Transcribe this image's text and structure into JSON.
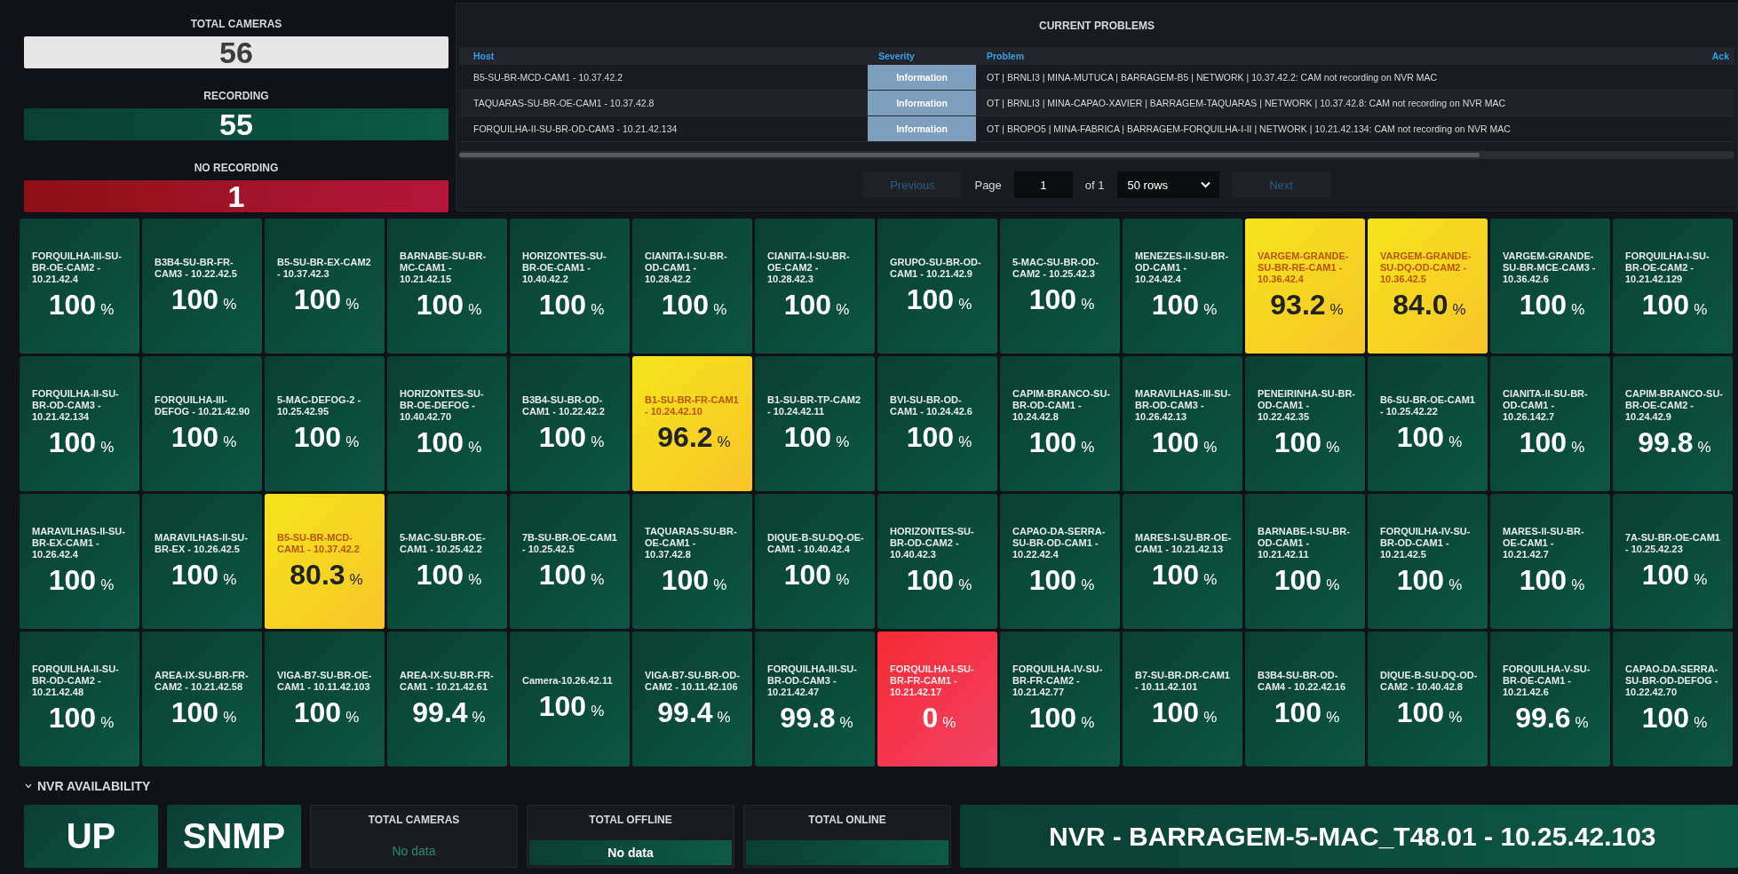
{
  "summary": [
    {
      "label": "TOTAL CAMERAS",
      "value": "56",
      "kind": "neutral"
    },
    {
      "label": "RECORDING",
      "value": "55",
      "kind": "ok"
    },
    {
      "label": "NO RECORDING",
      "value": "1",
      "kind": "critical"
    }
  ],
  "problems": {
    "title": "CURRENT PROBLEMS",
    "columns": [
      "Host",
      "Severity",
      "Problem",
      "Ack"
    ],
    "rows": [
      {
        "host": "B5-SU-BR-MCD-CAM1 - 10.37.42.2",
        "severity": "Information",
        "problem": "OT | BRNLI3 | MINA-MUTUCA | BARRAGEM-B5 | NETWORK | 10.37.42.2: CAM not recording on NVR MAC"
      },
      {
        "host": "TAQUARAS-SU-BR-OE-CAM1 - 10.37.42.8",
        "severity": "Information",
        "problem": "OT | BRNLI3 | MINA-CAPAO-XAVIER | BARRAGEM-TAQUARAS | NETWORK | 10.37.42.8: CAM not recording on NVR MAC"
      },
      {
        "host": "FORQUILHA-II-SU-BR-OD-CAM3 - 10.21.42.134",
        "severity": "Information",
        "problem": "OT | BROPO5 | MINA-FABRICA | BARRAGEM-FORQUILHA-I-II | NETWORK | 10.21.42.134: CAM not recording on NVR MAC"
      }
    ],
    "pagination": {
      "previous": "Previous",
      "page_label": "Page",
      "page": "1",
      "of": "of 1",
      "rows": "50 rows",
      "next": "Next"
    }
  },
  "tiles": [
    {
      "name": "FORQUILHA-III-SU-BR-OE-CAM2 - 10.21.42.4",
      "value": "100",
      "unit": "%",
      "color": "#0d5643"
    },
    {
      "name": "B3B4-SU-BR-FR-CAM3 - 10.22.42.5",
      "value": "100",
      "unit": "%",
      "color": "#0d5643"
    },
    {
      "name": "B5-SU-BR-EX-CAM2 - 10.37.42.3",
      "value": "100",
      "unit": "%",
      "color": "#0d5643"
    },
    {
      "name": "BARNABE-SU-BR-MC-CAM1 - 10.21.42.15",
      "value": "100",
      "unit": "%",
      "color": "#0d5643"
    },
    {
      "name": "HORIZONTES-SU-BR-OE-CAM1 - 10.40.42.2",
      "value": "100",
      "unit": "%",
      "color": "#0d5643"
    },
    {
      "name": "CIANITA-I-SU-BR-OD-CAM1 - 10.28.42.2",
      "value": "100",
      "unit": "%",
      "color": "#0d5643"
    },
    {
      "name": "CIANITA-I-SU-BR-OE-CAM2 - 10.28.42.3",
      "value": "100",
      "unit": "%",
      "color": "#0d5643"
    },
    {
      "name": "GRUPO-SU-BR-OD-CAM1 - 10.21.42.9",
      "value": "100",
      "unit": "%",
      "color": "#0d5643"
    },
    {
      "name": "5-MAC-SU-BR-OD-CAM2 - 10.25.42.3",
      "value": "100",
      "unit": "%",
      "color": "#0d5643"
    },
    {
      "name": "MENEZES-II-SU-BR-OD-CAM1 - 10.24.42.4",
      "value": "100",
      "unit": "%",
      "color": "#0d5643"
    },
    {
      "name": "VARGEM-GRANDE-SU-BR-RE-CAM1 - 10.36.42.4",
      "value": "93.2",
      "unit": "%",
      "color": "#f5e41a"
    },
    {
      "name": "VARGEM-GRANDE-SU-DQ-OD-CAM2 - 10.36.42.5",
      "value": "84.0",
      "unit": "%",
      "color": "#f5e41a"
    },
    {
      "name": "VARGEM-GRANDE-SU-BR-MCE-CAM3 - 10.36.42.6",
      "value": "100",
      "unit": "%",
      "color": "#0d5643"
    },
    {
      "name": "FORQUILHA-I-SU-BR-OE-CAM2 - 10.21.42.129",
      "value": "100",
      "unit": "%",
      "color": "#0d5643"
    },
    {
      "name": "FORQUILHA-II-SU-BR-OD-CAM3 - 10.21.42.134",
      "value": "100",
      "unit": "%",
      "color": "#0d5643"
    },
    {
      "name": "FORQUILHA-III-DEFOG - 10.21.42.90",
      "value": "100",
      "unit": "%",
      "color": "#0d5643"
    },
    {
      "name": "5-MAC-DEFOG-2 - 10.25.42.95",
      "value": "100",
      "unit": "%",
      "color": "#0d5643"
    },
    {
      "name": "HORIZONTES-SU-BR-OE-DEFOG - 10.40.42.70",
      "value": "100",
      "unit": "%",
      "color": "#0d5643"
    },
    {
      "name": "B3B4-SU-BR-OD-CAM1 - 10.22.42.2",
      "value": "100",
      "unit": "%",
      "color": "#0d5643"
    },
    {
      "name": "B1-SU-BR-FR-CAM1 - 10.24.42.10",
      "value": "96.2",
      "unit": "%",
      "color": "#f5e41a"
    },
    {
      "name": "B1-SU-BR-TP-CAM2 - 10.24.42.11",
      "value": "100",
      "unit": "%",
      "color": "#0d5643"
    },
    {
      "name": "BVI-SU-BR-OD-CAM1 - 10.24.42.6",
      "value": "100",
      "unit": "%",
      "color": "#0d5643"
    },
    {
      "name": "CAPIM-BRANCO-SU-BR-OD-CAM1 - 10.24.42.8",
      "value": "100",
      "unit": "%",
      "color": "#0d5643"
    },
    {
      "name": "MARAVILHAS-III-SU-BR-OD-CAM3 - 10.26.42.13",
      "value": "100",
      "unit": "%",
      "color": "#0d5643"
    },
    {
      "name": "PENEIRINHA-SU-BR-OD-CAM1 - 10.22.42.35",
      "value": "100",
      "unit": "%",
      "color": "#0d5643"
    },
    {
      "name": "B6-SU-BR-OE-CAM1 - 10.25.42.22",
      "value": "100",
      "unit": "%",
      "color": "#0d5643"
    },
    {
      "name": "CIANITA-II-SU-BR-OD-CAM1 - 10.26.142.7",
      "value": "100",
      "unit": "%",
      "color": "#0d5643"
    },
    {
      "name": "CAPIM-BRANCO-SU-BR-OE-CAM2 - 10.24.42.9",
      "value": "99.8",
      "unit": "%",
      "color": "#0d5643"
    },
    {
      "name": "MARAVILHAS-II-SU-BR-EX-CAM1 - 10.26.42.4",
      "value": "100",
      "unit": "%",
      "color": "#0d5643"
    },
    {
      "name": "MARAVILHAS-II-SU-BR-EX - 10.26.42.5",
      "value": "100",
      "unit": "%",
      "color": "#0d5643"
    },
    {
      "name": "B5-SU-BR-MCD-CAM1 - 10.37.42.2",
      "value": "80.3",
      "unit": "%",
      "color": "#f5e41a"
    },
    {
      "name": "5-MAC-SU-BR-OE-CAM1 - 10.25.42.2",
      "value": "100",
      "unit": "%",
      "color": "#0d5643"
    },
    {
      "name": "7B-SU-BR-OE-CAM1 - 10.25.42.5",
      "value": "100",
      "unit": "%",
      "color": "#0d5643"
    },
    {
      "name": "TAQUARAS-SU-BR-OE-CAM1 - 10.37.42.8",
      "value": "100",
      "unit": "%",
      "color": "#0d5643"
    },
    {
      "name": "DIQUE-B-SU-DQ-OE-CAM1 - 10.40.42.4",
      "value": "100",
      "unit": "%",
      "color": "#0d5643"
    },
    {
      "name": "HORIZONTES-SU-BR-OD-CAM2 - 10.40.42.3",
      "value": "100",
      "unit": "%",
      "color": "#0d5643"
    },
    {
      "name": "CAPAO-DA-SERRA-SU-BR-OD-CAM1 - 10.22.42.4",
      "value": "100",
      "unit": "%",
      "color": "#0d5643"
    },
    {
      "name": "MARES-I-SU-BR-OE-CAM1 - 10.21.42.13",
      "value": "100",
      "unit": "%",
      "color": "#0d5643"
    },
    {
      "name": "BARNABE-I-SU-BR-OD-CAM1 - 10.21.42.11",
      "value": "100",
      "unit": "%",
      "color": "#0d5643"
    },
    {
      "name": "FORQUILHA-IV-SU-BR-OD-CAM1 - 10.21.42.5",
      "value": "100",
      "unit": "%",
      "color": "#0d5643"
    },
    {
      "name": "MARES-II-SU-BR-OE-CAM1 - 10.21.42.7",
      "value": "100",
      "unit": "%",
      "color": "#0d5643"
    },
    {
      "name": "7A-SU-BR-OE-CAM1 - 10.25.42.23",
      "value": "100",
      "unit": "%",
      "color": "#0d5643"
    },
    {
      "name": "FORQUILHA-II-SU-BR-OD-CAM2 - 10.21.42.48",
      "value": "100",
      "unit": "%",
      "color": "#0d5643"
    },
    {
      "name": "AREA-IX-SU-BR-FR-CAM2 - 10.21.42.58",
      "value": "100",
      "unit": "%",
      "color": "#0d5643"
    },
    {
      "name": "VIGA-B7-SU-BR-OE-CAM1 - 10.11.42.103",
      "value": "100",
      "unit": "%",
      "color": "#0d5643"
    },
    {
      "name": "AREA-IX-SU-BR-FR-CAM1 - 10.21.42.61",
      "value": "99.4",
      "unit": "%",
      "color": "#0d5643"
    },
    {
      "name": "Camera-10.26.42.11",
      "value": "100",
      "unit": "%",
      "color": "#0d5643"
    },
    {
      "name": "VIGA-B7-SU-BR-OD-CAM2 - 10.11.42.106",
      "value": "99.4",
      "unit": "%",
      "color": "#0d5643"
    },
    {
      "name": "FORQUILHA-III-SU-BR-OD-CAM3 - 10.21.42.47",
      "value": "99.8",
      "unit": "%",
      "color": "#0d5643"
    },
    {
      "name": "FORQUILHA-I-SU-BR-FR-CAM1 - 10.21.42.17",
      "value": "0",
      "unit": "%",
      "color": "#f52a33"
    },
    {
      "name": "FORQUILHA-IV-SU-BR-FR-CAM2 - 10.21.42.77",
      "value": "100",
      "unit": "%",
      "color": "#0d5643"
    },
    {
      "name": "B7-SU-BR-DR-CAM1 - 10.11.42.101",
      "value": "100",
      "unit": "%",
      "color": "#0d5643"
    },
    {
      "name": "B3B4-SU-BR-OD-CAM4 - 10.22.42.16",
      "value": "100",
      "unit": "%",
      "color": "#0d5643"
    },
    {
      "name": "DIQUE-B-SU-DQ-OD-CAM2 - 10.40.42.8",
      "value": "100",
      "unit": "%",
      "color": "#0d5643"
    },
    {
      "name": "FORQUILHA-V-SU-BR-OE-CAM1 - 10.21.42.6",
      "value": "99.6",
      "unit": "%",
      "color": "#0d5643"
    },
    {
      "name": "CAPAO-DA-SERRA-SU-BR-OD-DEFOG - 10.22.42.70",
      "value": "100",
      "unit": "%",
      "color": "#0d5643"
    }
  ],
  "nvr": {
    "title": "NVR AVAILABILITY",
    "expanded": true,
    "panels": [
      {
        "kind": "status",
        "value": "UP"
      },
      {
        "kind": "status",
        "value": "SNMP"
      },
      {
        "kind": "stat",
        "label": "TOTAL CAMERAS",
        "value": "No data",
        "filled": false
      },
      {
        "kind": "stat",
        "label": "TOTAL OFFLINE",
        "value": "No data",
        "filled": true
      },
      {
        "kind": "stat",
        "label": "TOTAL ONLINE",
        "filled": true
      },
      {
        "kind": "name",
        "value": "NVR - BARRAGEM-5-MAC_T48.01 - 10.25.42.103"
      }
    ]
  }
}
